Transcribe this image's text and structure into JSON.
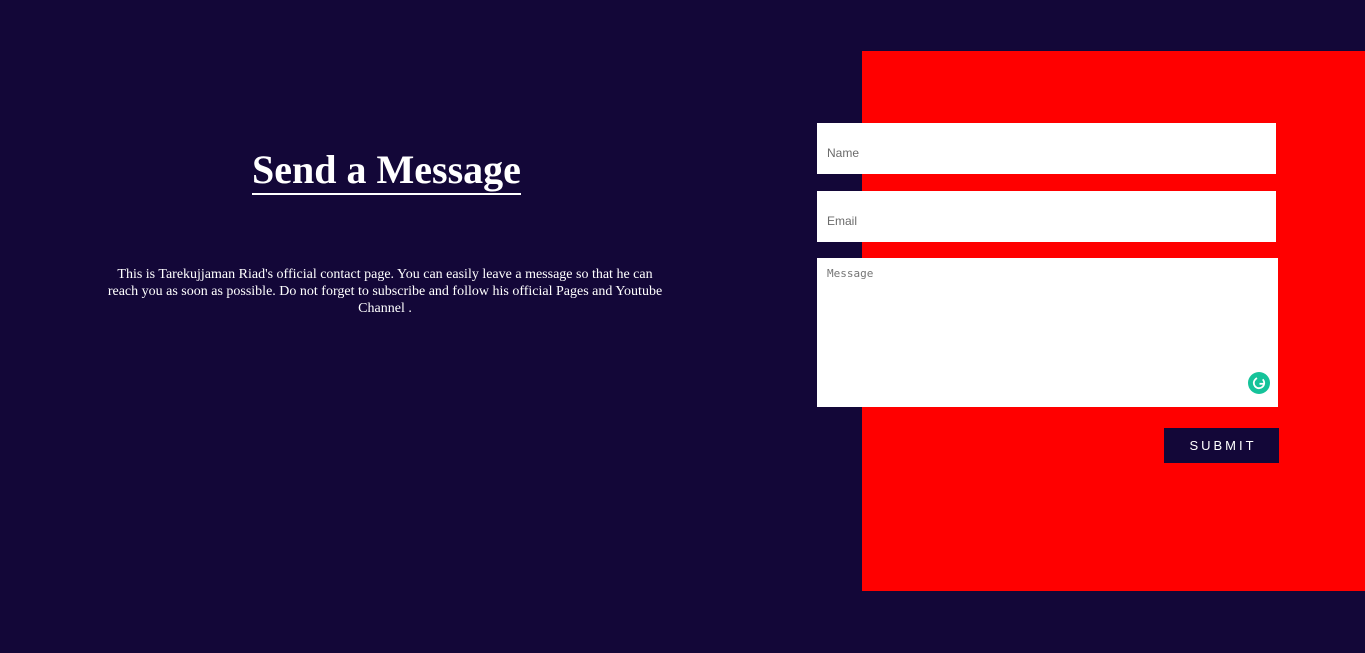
{
  "contact": {
    "heading": "Send a Message",
    "intro": "This is Tarekujjaman Riad's official contact page. You can easily leave a message so that he can reach you as soon as possible. Do not forget to subscribe and follow his official Pages and Youtube Channel ."
  },
  "form": {
    "name_placeholder": "Name",
    "email_placeholder": "Email",
    "message_placeholder": "Message",
    "submit_label": "SUBMIT",
    "extension_icon": "grammarly-icon"
  },
  "colors": {
    "background": "#130738",
    "panel": "#ff0000",
    "field": "#ffffff",
    "button": "#130738",
    "extension": "#15c39a"
  }
}
